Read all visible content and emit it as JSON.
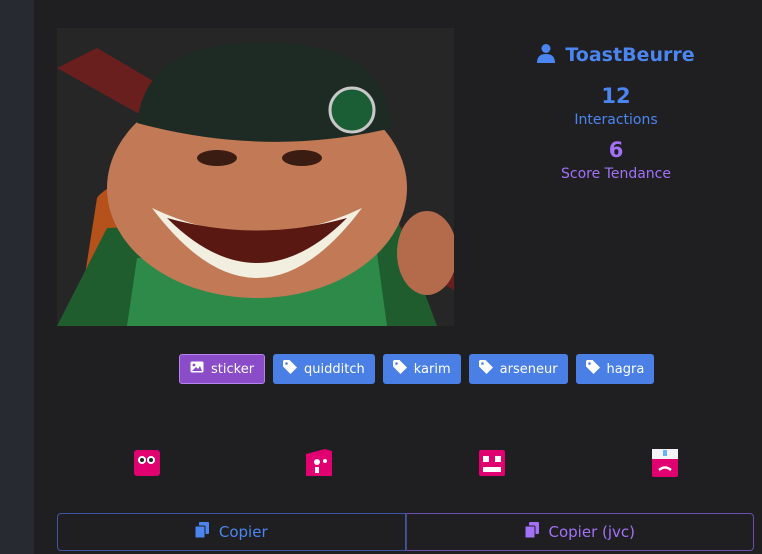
{
  "user": {
    "name": "ToastBeurre",
    "icon": "user-icon"
  },
  "stats": {
    "interactions_value": "12",
    "interactions_label": "Interactions",
    "trend_value": "6",
    "trend_label": "Score Tendance"
  },
  "image": {
    "icon": "sticker-image"
  },
  "tags": [
    {
      "label": "sticker",
      "icon": "image-icon",
      "kind": "category"
    },
    {
      "label": "quidditch",
      "icon": "tag-icon",
      "kind": "keyword"
    },
    {
      "label": "karim",
      "icon": "tag-icon",
      "kind": "keyword"
    },
    {
      "label": "arseneur",
      "icon": "tag-icon",
      "kind": "keyword"
    },
    {
      "label": "hagra",
      "icon": "tag-icon",
      "kind": "keyword"
    }
  ],
  "reactions": [
    "reaction-icon-1",
    "reaction-icon-2",
    "reaction-icon-3",
    "reaction-icon-4"
  ],
  "actions": {
    "copy_label": "Copier",
    "copy_jvc_label": "Copier (jvc)"
  },
  "colors": {
    "background": "#1f1f22",
    "blue": "#4b86f0",
    "purple": "#a371f7",
    "reaction_pink": "#e0006f"
  }
}
